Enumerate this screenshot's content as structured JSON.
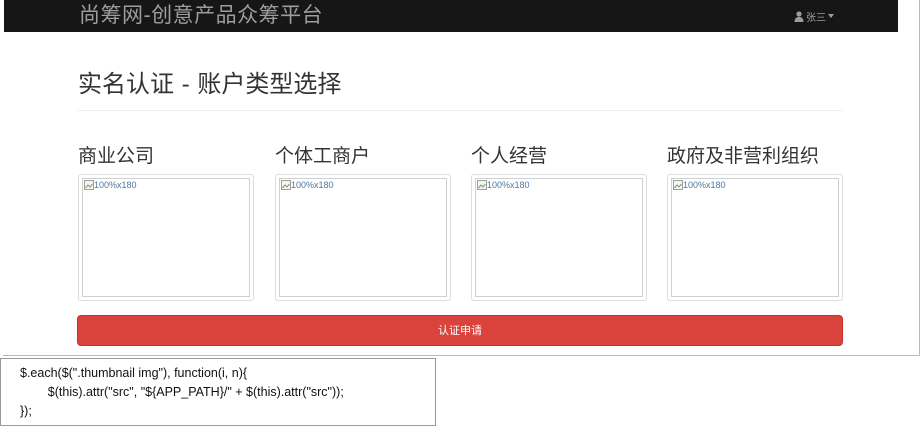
{
  "navbar": {
    "brand": "尚筹网-创意产品众筹平台",
    "user_name": "张三",
    "user_icon": "user-icon",
    "caret_icon": "caret-down-icon",
    "background": "#161616",
    "text_color": "#9d9d9d"
  },
  "page": {
    "title": "实名认证 - 账户类型选择"
  },
  "account_types": [
    {
      "title": "商业公司",
      "image_alt": "100%x180"
    },
    {
      "title": "个体工商户",
      "image_alt": "100%x180"
    },
    {
      "title": "个人经营",
      "image_alt": "100%x180"
    },
    {
      "title": "政府及非营利组织",
      "image_alt": "100%x180"
    }
  ],
  "apply_button": {
    "label": "认证申请",
    "color": "#d9433b"
  },
  "code_snippet": {
    "lines": [
      "$.each($(\".thumbnail img\"), function(i, n){",
      "        $(this).attr(\"src\", \"${APP_PATH}/\" + $(this).attr(\"src\"));",
      "});"
    ]
  }
}
